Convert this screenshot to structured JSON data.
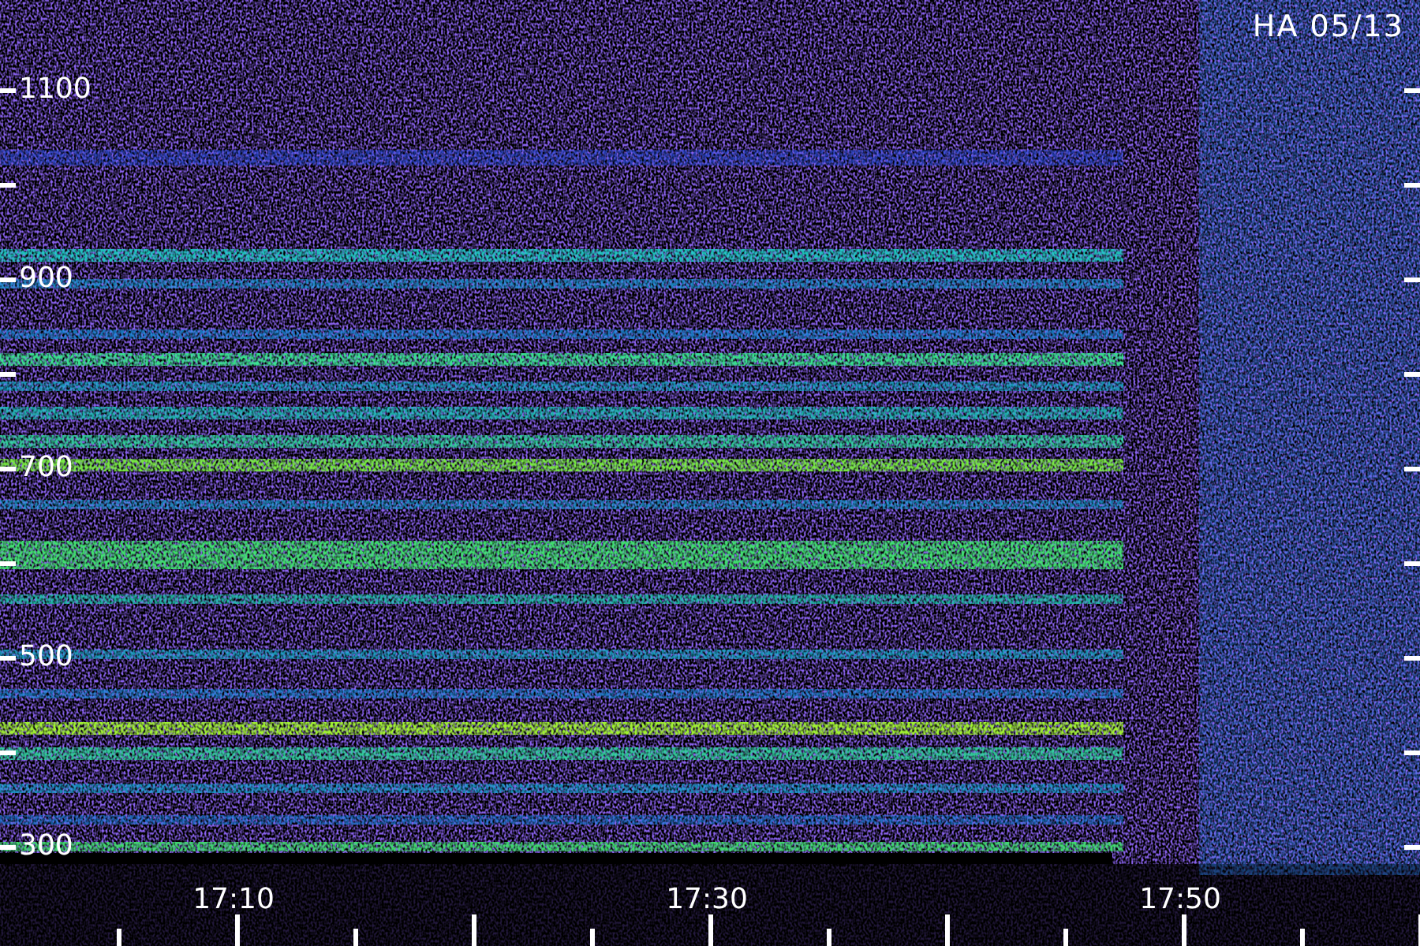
{
  "title": "HA 05/13",
  "y_axis": {
    "labels": [
      "1100",
      "900",
      "700",
      "500",
      "300"
    ]
  },
  "x_axis": {
    "labels": [
      "17:10",
      "17:30",
      "17:50"
    ]
  }
}
